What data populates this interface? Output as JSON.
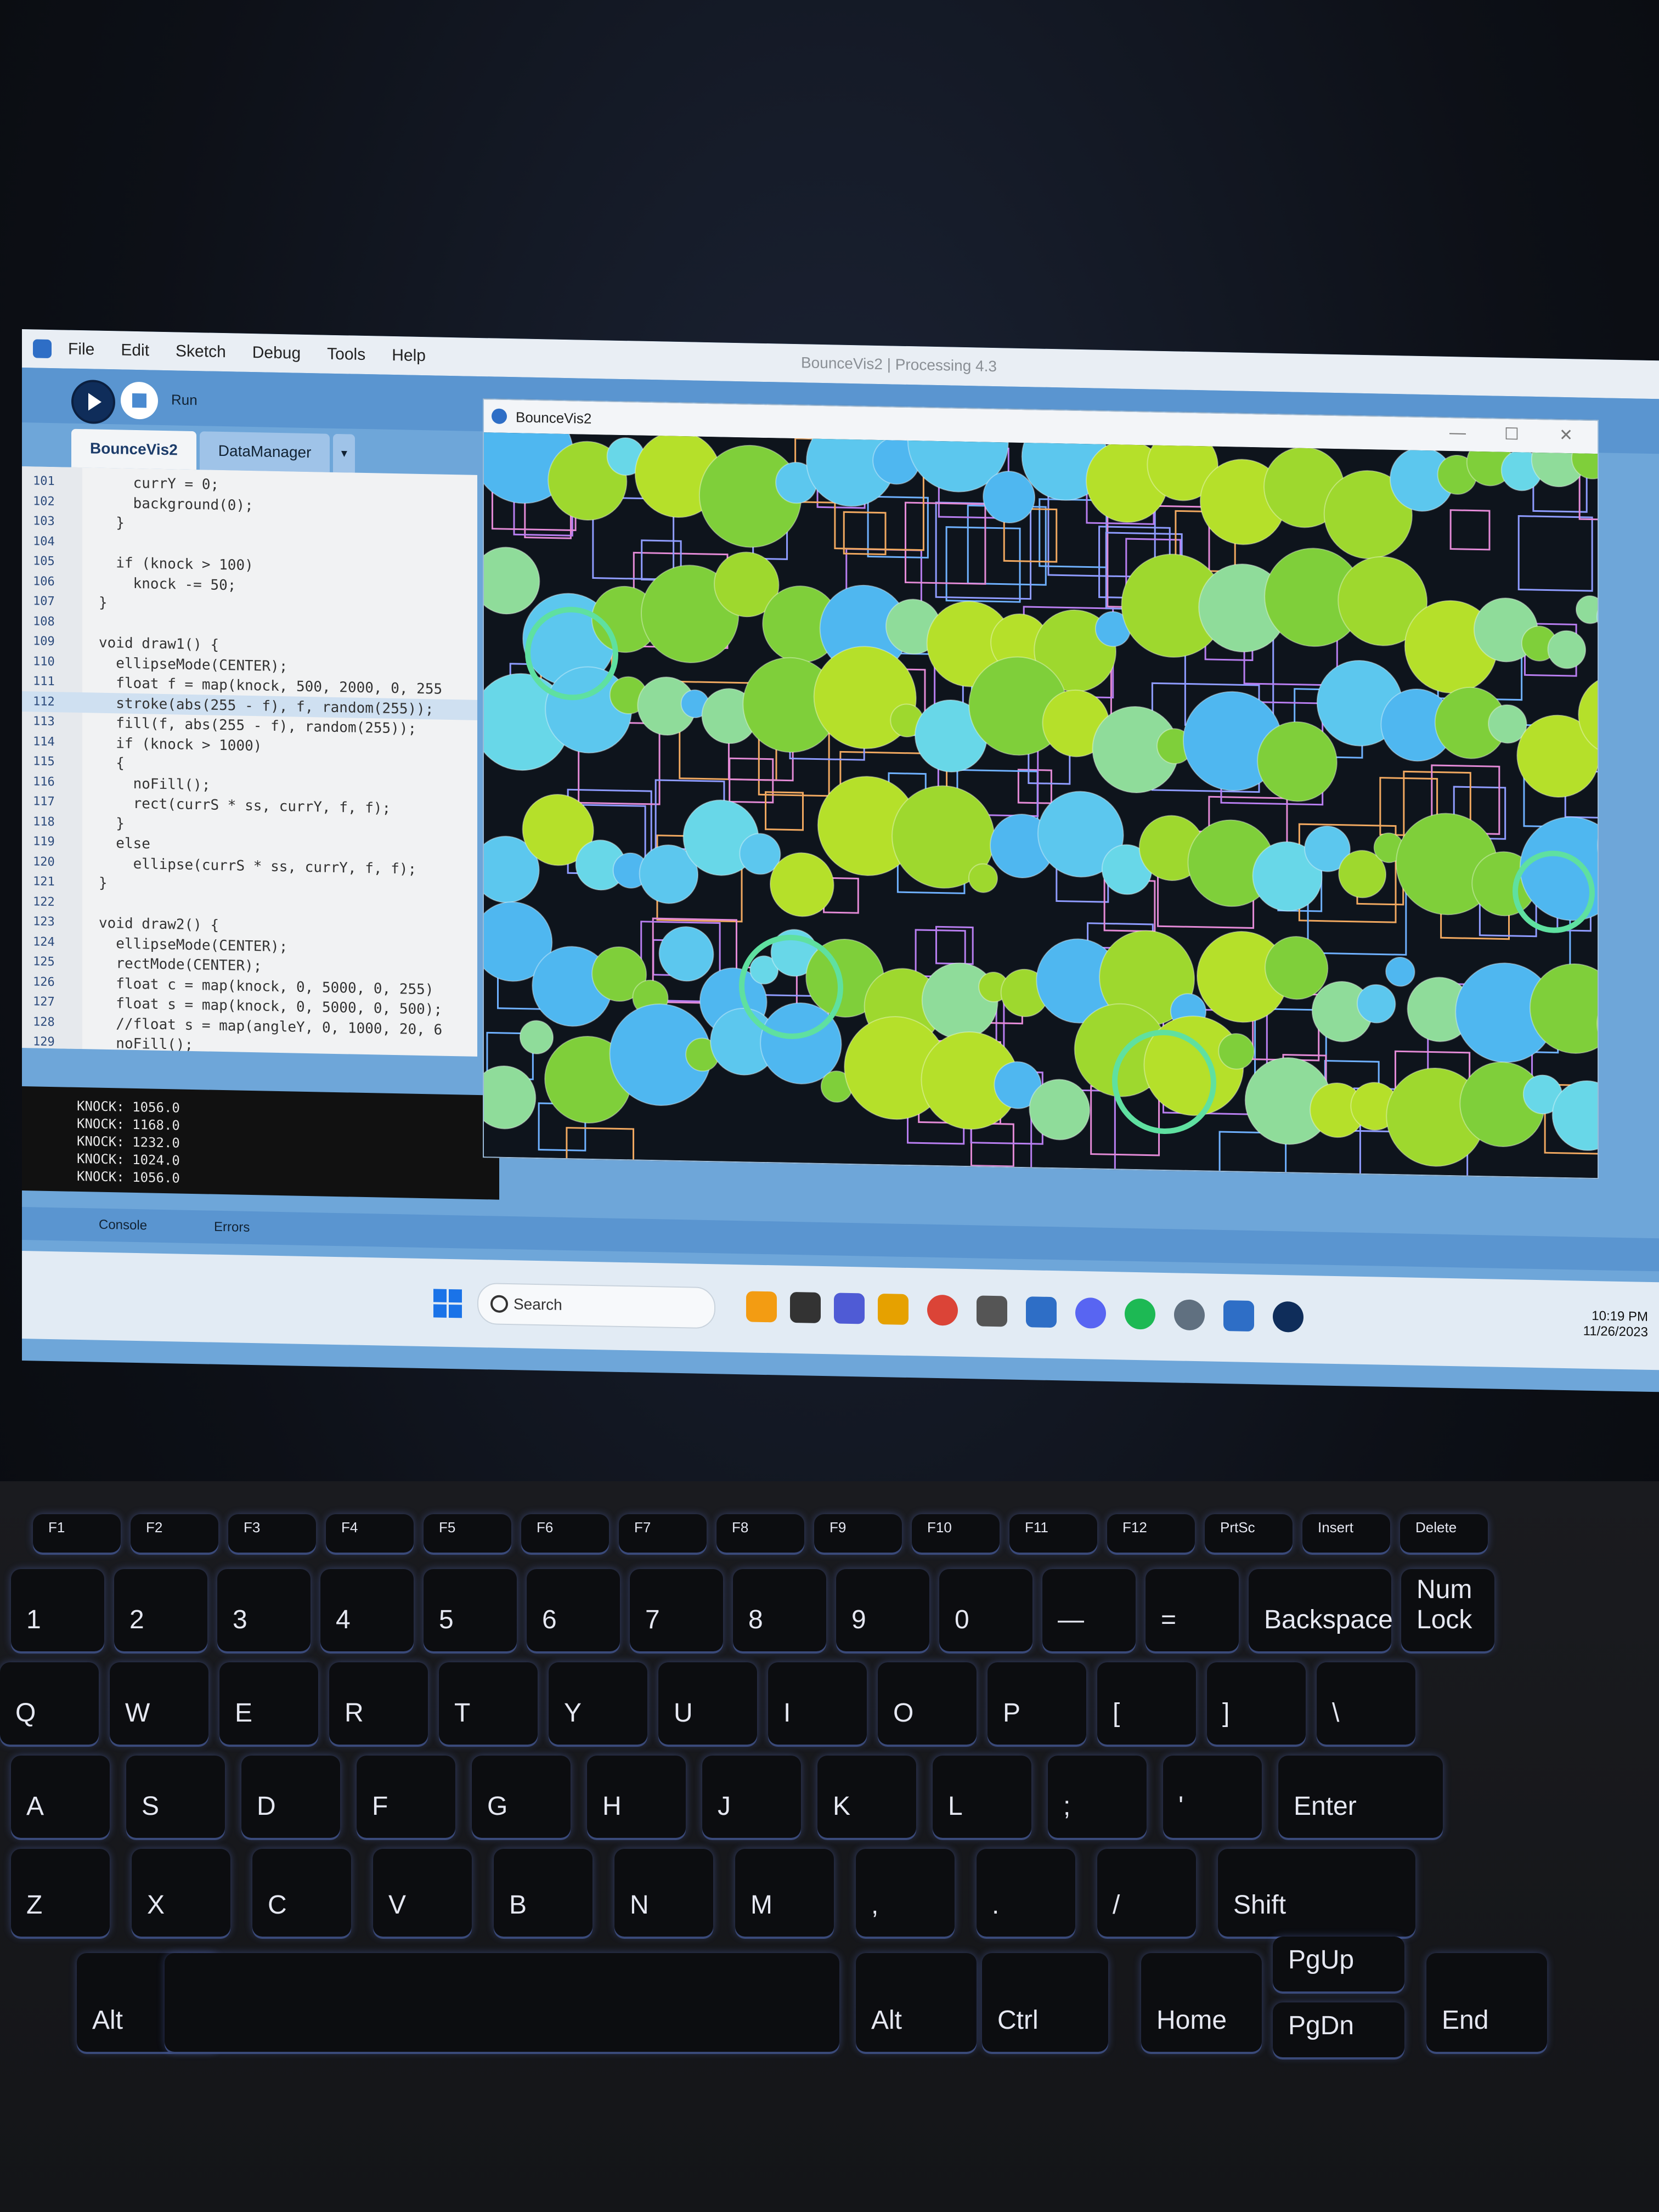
{
  "ide": {
    "menu": [
      "File",
      "Edit",
      "Sketch",
      "Debug",
      "Tools",
      "Help"
    ],
    "window_title": "BounceVis2 | Processing 4.3",
    "run_label": "Run",
    "tabs": [
      "BounceVis2",
      "DataManager"
    ],
    "tab_arrow": "▾",
    "code": [
      {
        "ln": "101",
        "text": "    currY = 0;"
      },
      {
        "ln": "102",
        "text": "    background(0);"
      },
      {
        "ln": "103",
        "text": "  }"
      },
      {
        "ln": "104",
        "text": ""
      },
      {
        "ln": "105",
        "text": "  if (knock > 100)"
      },
      {
        "ln": "106",
        "text": "    knock -= 50;"
      },
      {
        "ln": "107",
        "text": "}"
      },
      {
        "ln": "108",
        "text": ""
      },
      {
        "ln": "109",
        "text": "void draw1() {"
      },
      {
        "ln": "110",
        "text": "  ellipseMode(CENTER);"
      },
      {
        "ln": "111",
        "text": "  float f = map(knock, 500, 2000, 0, 255"
      },
      {
        "ln": "112",
        "text": "  stroke(abs(255 - f), f, random(255));"
      },
      {
        "ln": "113",
        "text": "  fill(f, abs(255 - f), random(255));"
      },
      {
        "ln": "114",
        "text": "  if (knock > 1000)"
      },
      {
        "ln": "115",
        "text": "  {"
      },
      {
        "ln": "116",
        "text": "    noFill();"
      },
      {
        "ln": "117",
        "text": "    rect(currS * ss, currY, f, f);"
      },
      {
        "ln": "118",
        "text": "  }"
      },
      {
        "ln": "119",
        "text": "  else"
      },
      {
        "ln": "120",
        "text": "    ellipse(currS * ss, currY, f, f);"
      },
      {
        "ln": "121",
        "text": "}"
      },
      {
        "ln": "122",
        "text": ""
      },
      {
        "ln": "123",
        "text": "void draw2() {"
      },
      {
        "ln": "124",
        "text": "  ellipseMode(CENTER);"
      },
      {
        "ln": "125",
        "text": "  rectMode(CENTER);"
      },
      {
        "ln": "126",
        "text": "  float c = map(knock, 0, 5000, 0, 255)"
      },
      {
        "ln": "127",
        "text": "  float s = map(knock, 0, 5000, 0, 500);"
      },
      {
        "ln": "128",
        "text": "  //float s = map(angleY, 0, 1000, 20, 6"
      },
      {
        "ln": "129",
        "text": "  noFill();"
      }
    ],
    "highlighted_line": "112",
    "console": [
      "KNOCK: 1056.0",
      "KNOCK: 1168.0",
      "KNOCK: 1232.0",
      "KNOCK: 1024.0",
      "KNOCK: 1056.0"
    ],
    "console_tabs": [
      "Console",
      "Errors"
    ]
  },
  "sketch_window": {
    "title": "BounceVis2",
    "controls": [
      "—",
      "☐",
      "✕"
    ]
  },
  "taskbar": {
    "search_placeholder": "Search",
    "time": "10:19 PM",
    "date": "11/26/2023"
  },
  "keyboard": {
    "fn_row": [
      "F1",
      "F2",
      "F3",
      "F4",
      "F5",
      "F6",
      "F7",
      "F8",
      "F9",
      "F10",
      "F11",
      "F12",
      "PrtSc",
      "Insert",
      "Delete"
    ],
    "num_row": [
      "1",
      "2",
      "3",
      "4",
      "5",
      "6",
      "7",
      "8",
      "9",
      "0",
      "—",
      "=",
      "Backspace",
      "Num Lock"
    ],
    "row_q": [
      "Q",
      "W",
      "E",
      "R",
      "T",
      "Y",
      "U",
      "I",
      "O",
      "P",
      "[",
      "]",
      "\\"
    ],
    "row_a": [
      "A",
      "S",
      "D",
      "F",
      "G",
      "H",
      "J",
      "K",
      "L",
      ";",
      "'",
      "Enter"
    ],
    "row_z": [
      "Z",
      "X",
      "C",
      "V",
      "B",
      "N",
      "M",
      ",",
      ".",
      "/",
      "Shift"
    ],
    "row_bottom": [
      "Alt",
      "Alt",
      "Ctrl",
      "Home",
      "PgUp",
      "PgDn",
      "End"
    ]
  }
}
